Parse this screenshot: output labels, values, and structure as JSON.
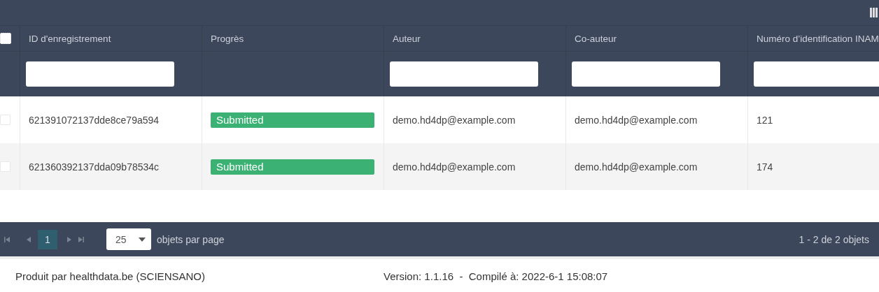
{
  "table": {
    "select_all": {
      "checked": false
    },
    "columns": [
      {
        "label": "ID d'enregistrement",
        "filter": true
      },
      {
        "label": "Progrès",
        "filter": false
      },
      {
        "label": "Auteur",
        "filter": true
      },
      {
        "label": "Co-auteur",
        "filter": true
      },
      {
        "label": "Numéro d’identification INAM",
        "filter": true
      }
    ],
    "rows": [
      {
        "checked": false,
        "cells": [
          "621391072137dde8ce79a594",
          "Submitted",
          "demo.hd4dp@example.com",
          "demo.hd4dp@example.com",
          "121"
        ]
      },
      {
        "checked": false,
        "cells": [
          "621360392137dda09b78534c",
          "Submitted",
          "demo.hd4dp@example.com",
          "demo.hd4dp@example.com",
          "174"
        ]
      }
    ]
  },
  "pager": {
    "pages": [
      {
        "label": "1",
        "selected": true
      }
    ],
    "per_page": "25",
    "per_page_label": "objets par page",
    "summary": "1 - 2 de 2 objets"
  },
  "footer": {
    "producer": "Produit par healthdata.be (SCIENSANO)",
    "version": "Version: 1.1.16  -  Compilé à: 2022-6-1 15:08:07"
  }
}
